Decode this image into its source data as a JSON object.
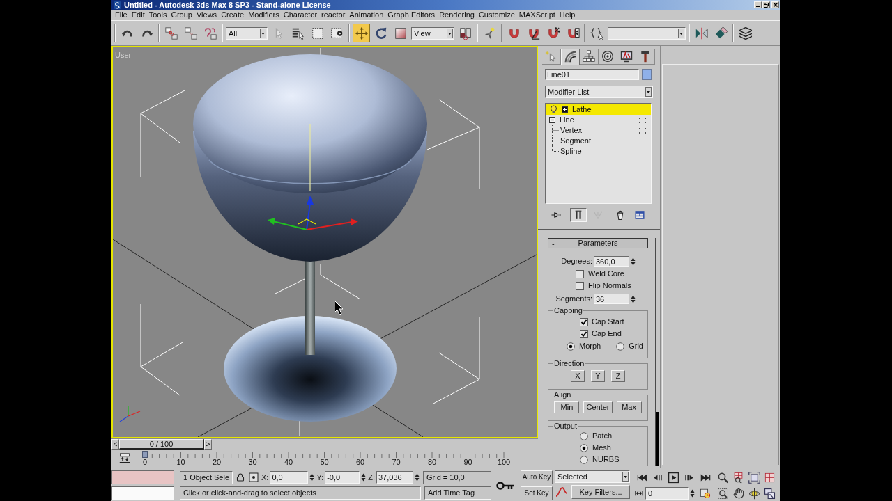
{
  "window": {
    "title": "Untitled - Autodesk 3ds Max 8 SP3 - Stand-alone License"
  },
  "menu": [
    "File",
    "Edit",
    "Tools",
    "Group",
    "Views",
    "Create",
    "Modifiers",
    "Character",
    "reactor",
    "Animation",
    "Graph Editors",
    "Rendering",
    "Customize",
    "MAXScript",
    "Help"
  ],
  "toolbar": {
    "buttons": [
      {
        "selected": false
      },
      {
        "selected": false
      },
      {
        "selected": false
      },
      {
        "selected": false
      },
      {
        "selected": false
      },
      {
        "selected": false
      },
      {
        "selected": false
      },
      {
        "selected": false
      },
      {
        "selected": false
      },
      {
        "selected": true
      },
      {
        "selected": false
      },
      {
        "selected": false
      },
      {
        "selected": false
      },
      {
        "selected": false
      },
      {
        "selected": false
      },
      {
        "selected": false
      },
      {
        "selected": false
      },
      {
        "selected": false
      },
      {
        "selected": false
      },
      {
        "selected": false
      },
      {
        "selected": false
      },
      {
        "selected": false
      }
    ],
    "selection_filter": "All",
    "reference_coordinate_system": "View"
  },
  "viewport": {
    "label": "User",
    "active": true
  },
  "time_slider": {
    "prev": "<",
    "label": "0 / 100",
    "next": ">",
    "level": 0
  },
  "trackbar": {
    "labels": [
      "0",
      "10",
      "20",
      "30",
      "40",
      "50",
      "60",
      "70",
      "80",
      "90",
      "100"
    ]
  },
  "command_panel": {
    "tabs": [
      {
        "selected": false
      },
      {
        "selected": true
      },
      {
        "selected": false
      },
      {
        "selected": false
      },
      {
        "selected": false
      },
      {
        "selected": false
      }
    ],
    "object_name": "Line01",
    "modifier_list": "Modifier List",
    "stack": [
      {
        "kind": "modifier",
        "label": "Lathe",
        "selected": true,
        "on": true,
        "expanded": false
      },
      {
        "kind": "object",
        "label": "Line",
        "selected": false,
        "expanded": true,
        "level_icon": true,
        "children": [
          {
            "label": "Vertex",
            "selected": false,
            "level_icon": true
          },
          {
            "label": "Segment",
            "selected": false,
            "level_icon": false
          },
          {
            "label": "Spline",
            "selected": false,
            "level_icon": false
          }
        ]
      }
    ],
    "stack_buttons": [
      {
        "pressed": false,
        "disabled": false
      },
      {
        "pressed": true,
        "disabled": false
      },
      {
        "pressed": false,
        "disabled": true
      },
      {
        "pressed": false,
        "disabled": false
      },
      {
        "pressed": false,
        "disabled": false
      }
    ],
    "rollout": {
      "sign": "-",
      "title": "Parameters",
      "degrees": {
        "label": "Degrees:",
        "value": "360,0"
      },
      "weld_core": {
        "label": "Weld Core",
        "checked": false
      },
      "flip_normals": {
        "label": "Flip Normals",
        "checked": false
      },
      "segments": {
        "label": "Segments:",
        "value": "36"
      },
      "capping": {
        "title": "Capping",
        "checks": [
          {
            "label": "Cap Start",
            "checked": true
          },
          {
            "label": "Cap End",
            "checked": true
          }
        ],
        "options": [
          {
            "label": "Morph",
            "selected": true
          },
          {
            "label": "Grid",
            "selected": false
          }
        ]
      },
      "direction": {
        "title": "Direction",
        "buttons": [
          "X",
          "Y",
          "Z"
        ]
      },
      "align": {
        "title": "Align",
        "buttons": [
          "Min",
          "Center",
          "Max"
        ]
      },
      "output": {
        "title": "Output",
        "options": [
          {
            "label": "Patch",
            "selected": false
          },
          {
            "label": "Mesh",
            "selected": true
          },
          {
            "label": "NURBS",
            "selected": false
          }
        ]
      }
    }
  },
  "status_bar": {
    "selection": "1 Object Sele",
    "x": {
      "label": "X:",
      "value": "0,0"
    },
    "y": {
      "label": "Y:",
      "value": "-0,0"
    },
    "z": {
      "label": "Z:",
      "value": "37,036"
    },
    "grid": "Grid = 10,0",
    "prompt": "Click or click-and-drag to select objects",
    "time_tag": "Add Time Tag"
  },
  "animation_controls": {
    "auto_key": "Auto Key",
    "set_key": "Set Key",
    "key_set": "Selected",
    "key_filters": "Key Filters...",
    "frame": "0"
  }
}
